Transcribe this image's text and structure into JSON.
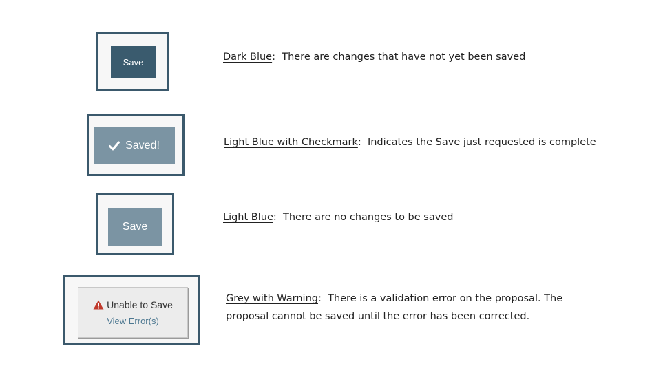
{
  "rows": [
    {
      "button_label": "Save",
      "term": "Dark Blue",
      "description": "There are changes that have not yet been saved"
    },
    {
      "button_label": "Saved!",
      "icon": "checkmark-icon",
      "term": "Light Blue with Checkmark",
      "description": "Indicates the Save just requested is complete"
    },
    {
      "button_label": "Save",
      "term": "Light Blue",
      "description": "There are no changes to be saved"
    },
    {
      "button_label": "Unable to Save",
      "button_sublabel": "View Error(s)",
      "icon": "warning-icon",
      "term": "Grey with Warning",
      "description_line1": "There is a validation error on the proposal.  The",
      "description_line2": "proposal cannot be saved until the error has been corrected."
    }
  ],
  "colors": {
    "frame": "#3b596c",
    "dark_blue": "#3a5b6e",
    "light_blue": "#7b94a3",
    "grey": "#ececec",
    "warning_red": "#c0392b",
    "link_blue": "#4d7891"
  }
}
